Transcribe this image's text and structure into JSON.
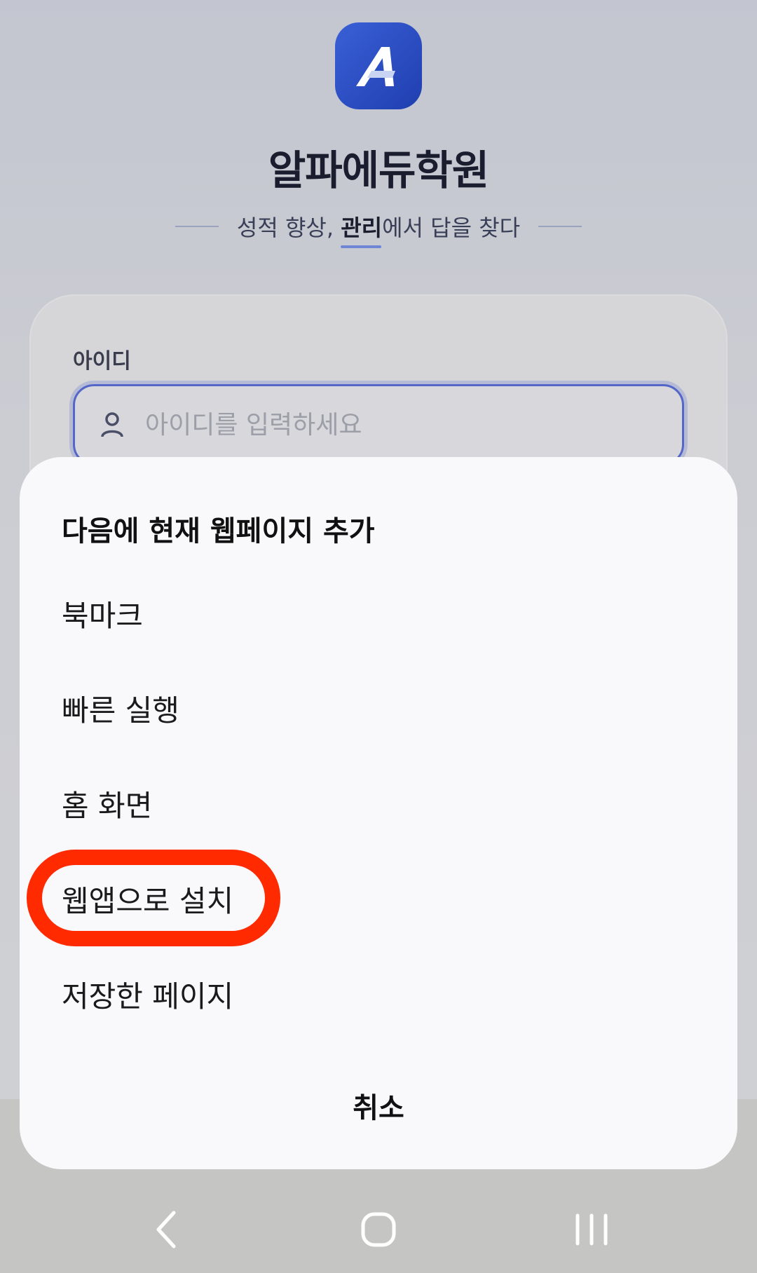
{
  "background": {
    "brand_name": "알파에듀학원",
    "tagline_part1": "성적 향상, ",
    "tagline_bold": "관리",
    "tagline_part2": "에서 답을 찾다",
    "id_label": "아이디",
    "id_placeholder": "아이디를 입력하세요"
  },
  "sheet": {
    "title": "다음에 현재 웹페이지 추가",
    "items": [
      {
        "label": "북마크"
      },
      {
        "label": "빠른 실행"
      },
      {
        "label": "홈 화면"
      },
      {
        "label": "웹앱으로 설치"
      },
      {
        "label": "저장한 페이지"
      }
    ],
    "cancel_label": "취소"
  },
  "navbar": {
    "icons": [
      "back-icon",
      "home-icon",
      "recent-apps-icon"
    ]
  },
  "colors": {
    "brand_blue": "#2a4fc8",
    "highlight_red": "#ff2a00"
  }
}
